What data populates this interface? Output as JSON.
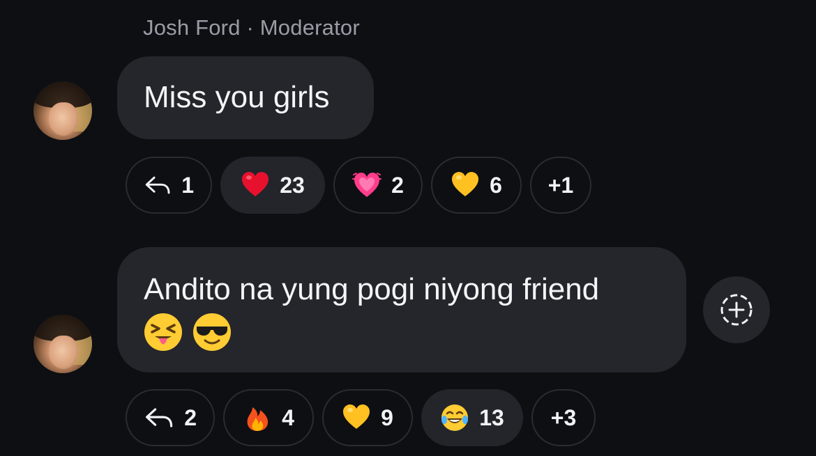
{
  "thread": {
    "sender_name": "Josh Ford · Moderator"
  },
  "messages": [
    {
      "text": "Miss you girls",
      "emojis": [],
      "reactions": {
        "reply_count": "1",
        "items": [
          {
            "icon": "red-heart-icon",
            "count": "23",
            "active": true
          },
          {
            "icon": "growing-heart-icon",
            "count": "2",
            "active": false
          },
          {
            "icon": "yellow-heart-icon",
            "count": "6",
            "active": false
          }
        ],
        "more": "+1"
      }
    },
    {
      "text": "Andito na yung pogi niyong friend",
      "emojis": [
        "squinting-tongue-face-icon",
        "sunglasses-face-icon"
      ],
      "reactions": {
        "reply_count": "2",
        "items": [
          {
            "icon": "fire-icon",
            "count": "4",
            "active": false
          },
          {
            "icon": "yellow-heart-icon",
            "count": "9",
            "active": false
          },
          {
            "icon": "tears-of-joy-face-icon",
            "count": "13",
            "active": true
          }
        ],
        "more": "+3"
      }
    }
  ],
  "colors": {
    "background": "#0d0f13",
    "bubble": "#24262c",
    "pill_border": "#2a2c32",
    "sender_text": "#9a9da6"
  }
}
